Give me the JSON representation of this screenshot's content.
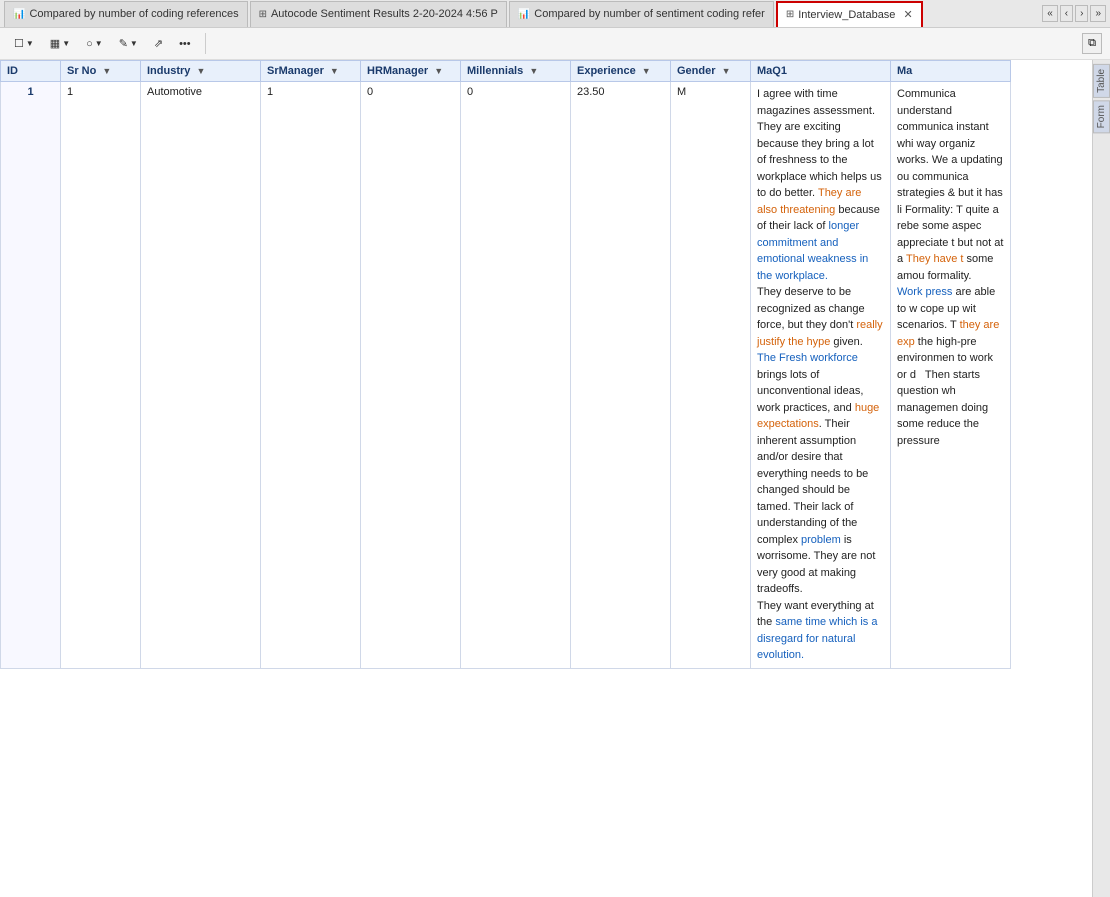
{
  "tabs": [
    {
      "id": "tab1",
      "icon": "chart-bar",
      "label": "Compared by number of coding references",
      "active": false,
      "closable": false
    },
    {
      "id": "tab2",
      "icon": "table-grid",
      "label": "Autocode Sentiment Results 2-20-2024 4:56 P",
      "active": false,
      "closable": false
    },
    {
      "id": "tab3",
      "icon": "chart-bar",
      "label": "Compared by number of sentiment coding refer",
      "active": false,
      "closable": false
    },
    {
      "id": "tab4",
      "icon": "table-grid",
      "label": "Interview_Database",
      "active": true,
      "closable": true
    }
  ],
  "nav_buttons": [
    "«",
    "‹",
    "›",
    "»"
  ],
  "toolbar": {
    "groups": [
      {
        "buttons": [
          {
            "name": "checkbox-view",
            "label": "☐",
            "has_chevron": true
          },
          {
            "name": "bar-view",
            "label": "▦",
            "has_chevron": true
          },
          {
            "name": "circle-view",
            "label": "○",
            "has_chevron": true
          },
          {
            "name": "pencil-view",
            "label": "✎",
            "has_chevron": true
          },
          {
            "name": "link-view",
            "label": "⇗",
            "has_chevron": false
          },
          {
            "name": "more-view",
            "label": "...",
            "has_chevron": false
          }
        ]
      }
    ],
    "maximize_label": "⧉"
  },
  "table": {
    "columns": [
      {
        "key": "id",
        "label": "ID",
        "filterable": false
      },
      {
        "key": "srno",
        "label": "Sr No",
        "filterable": true
      },
      {
        "key": "industry",
        "label": "Industry",
        "filterable": true
      },
      {
        "key": "srmanager",
        "label": "SrManager",
        "filterable": true
      },
      {
        "key": "hrmanager",
        "label": "HRManager",
        "filterable": true
      },
      {
        "key": "millennials",
        "label": "Millennials",
        "filterable": true
      },
      {
        "key": "experience",
        "label": "Experience",
        "filterable": true
      },
      {
        "key": "gender",
        "label": "Gender",
        "filterable": true
      },
      {
        "key": "maq1",
        "label": "MaQ1",
        "filterable": false
      },
      {
        "key": "ma",
        "label": "Ma",
        "filterable": false
      }
    ],
    "rows": [
      {
        "id": "1",
        "srno": "1",
        "industry": "Automotive",
        "srmanager": "1",
        "hrmanager": "0",
        "millennials": "0",
        "experience": "23.50",
        "gender": "M",
        "maq1_segments": [
          {
            "text": "I agree with time magazines assessment. They are exciting because they bring a lot of freshness to the workplace which helps us to do better. ",
            "color": "normal"
          },
          {
            "text": "They are also threatening",
            "color": "orange"
          },
          {
            "text": " because of their lack of longer commitment and emotional weakness in the workplace.",
            "color": "normal"
          },
          {
            "text": "\nThey deserve to be recognized as change force, but they don't",
            "color": "normal"
          },
          {
            "text": " really justify the hype",
            "color": "blue"
          },
          {
            "text": " given.",
            "color": "normal"
          },
          {
            "text": "\nThe Fresh workforce",
            "color": "blue"
          },
          {
            "text": " brings lots of unconventional ideas, work practices, and ",
            "color": "normal"
          },
          {
            "text": "huge expectations",
            "color": "orange"
          },
          {
            "text": ". Their inherent assumption and/or desire that everything needs to be changed should be tamed. Their lack of understanding of the complex problem is worrisome. They are not very good at making tradeoffs.\nThey want everything at the same time which is a disregard for natural evolution.",
            "color": "normal"
          }
        ],
        "ma_segments": [
          {
            "text": "Communica understand communica instant whi way organiz works. We a updating ou communica strategies & but it has li Formality: T quite a rebe some aspec appreciate t but not at a They have t some amou formality.",
            "color": "normal"
          },
          {
            "text": "\n Work press",
            "color": "blue"
          },
          {
            "text": " are able to w cope up wit scenarios. T",
            "color": "normal"
          },
          {
            "text": " they are exp",
            "color": "orange"
          },
          {
            "text": " the high-pre environmen to work or d   Then starts question wh managemen doing some reduce the pressure",
            "color": "normal"
          }
        ]
      }
    ]
  },
  "right_tabs": [
    "Table",
    "Form"
  ]
}
